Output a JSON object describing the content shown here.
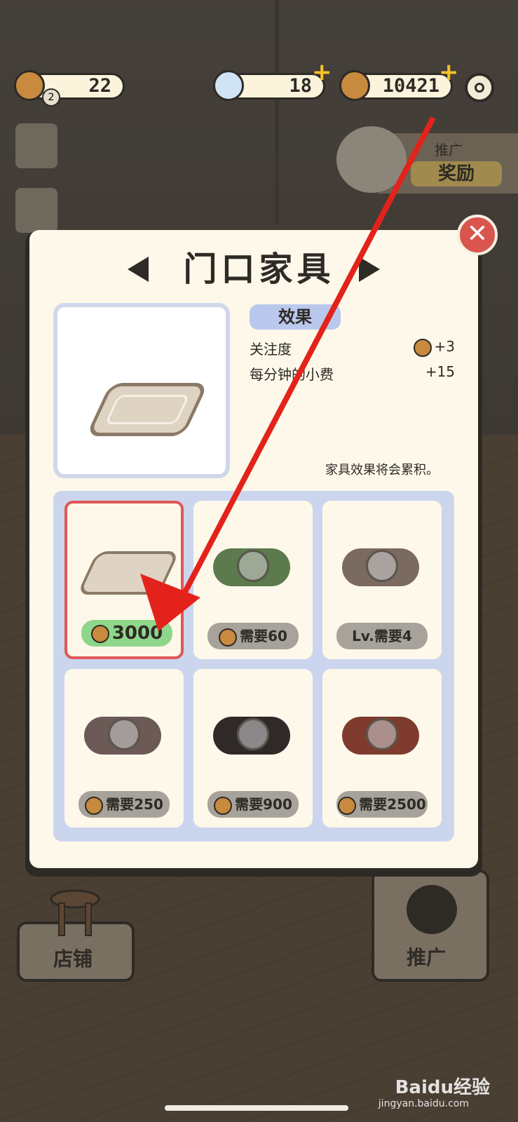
{
  "hud": {
    "hearts": {
      "value": "22",
      "badge": "2"
    },
    "diamonds": {
      "value": "18"
    },
    "coins": {
      "value": "10421"
    },
    "plus": "+"
  },
  "promo": {
    "title": "推广",
    "reward": "奖励"
  },
  "dialog": {
    "title": "门口家具",
    "close": "✕",
    "effect_tag": "效果",
    "effects": [
      {
        "label": "关注度",
        "value": "+3"
      },
      {
        "label": "每分钟的小费",
        "value": "+15"
      }
    ],
    "note": "家具效果将会累积。"
  },
  "items": [
    {
      "price": "3000",
      "selected": true,
      "rug_color": "#dfd3c4"
    },
    {
      "price": "需要60",
      "rug_color": "#5c7a4d"
    },
    {
      "price": "需要4",
      "prefix": "Lv.",
      "rug_color": "#7a6a60"
    },
    {
      "price": "需要250",
      "rug_color": "#6b5a56"
    },
    {
      "price": "需要900",
      "rug_color": "#2f2a28"
    },
    {
      "price": "需要2500",
      "rug_color": "#7e3b2e"
    }
  ],
  "bottom": {
    "shop": "店铺",
    "promote": "推广"
  },
  "watermark": {
    "brand": "Baidu经验",
    "url": "jingyan.baidu.com"
  },
  "colors": {
    "accent": "#e15755",
    "price_green": "#8fd68b",
    "panel": "#fdf8ea",
    "arrow": "#e3231b"
  }
}
